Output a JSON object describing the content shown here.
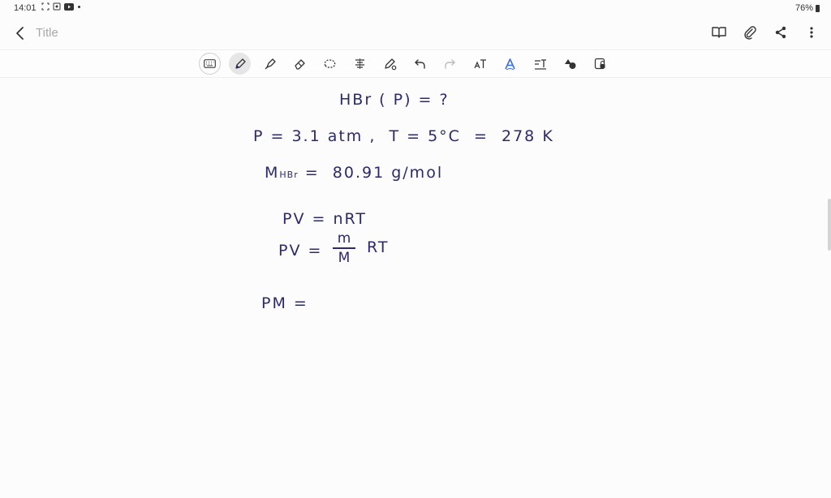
{
  "status": {
    "time": "14:01",
    "battery": "76%"
  },
  "header": {
    "title": "Title"
  },
  "colors": {
    "ink": "#2b2a6b",
    "ui": "#333333"
  },
  "icons": {
    "top": [
      "book-icon",
      "attach-icon",
      "share-icon",
      "more-icon"
    ],
    "tools": [
      "keyboard-icon",
      "pen-icon",
      "highlighter-icon",
      "eraser-icon",
      "lasso-icon",
      "text-align-icon",
      "pen-settings-icon",
      "undo-icon",
      "redo-icon",
      "text-tool-icon",
      "handwriting-icon",
      "text-convert-icon",
      "shapes-icon",
      "lock-icon"
    ]
  },
  "note": {
    "line1": "HBr ( P) = ?",
    "line2": "P = 3.1 atm ,  T = 5°C  =  278 K",
    "line3_main": "M",
    "line3_sub": "HBr",
    "line3_rest": " =  80.91 g/mol",
    "line4": "PV = nRT",
    "line5_left": "PV =",
    "line5_num": "m",
    "line5_den": "M",
    "line5_right": "RT",
    "line6": "PM ="
  }
}
